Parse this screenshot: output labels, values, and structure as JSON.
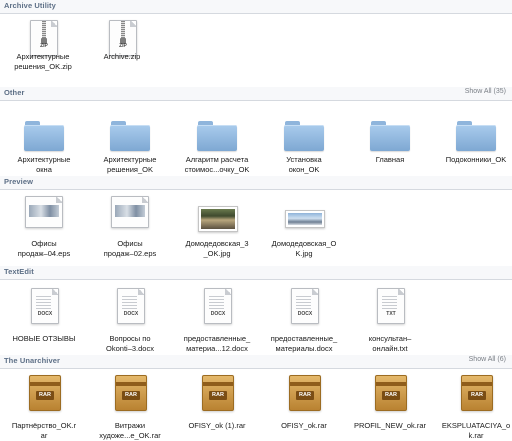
{
  "sections": [
    {
      "title": "Archive Utility",
      "show_all": "",
      "items": [
        {
          "label": "Архитектурные\nрешения_OK.zip",
          "kind": "zip",
          "tag": "ZIP"
        },
        {
          "label": "Archive.zip",
          "kind": "zip",
          "tag": "ZIP"
        }
      ]
    },
    {
      "title": "Other",
      "show_all": "Show All (35)",
      "items": [
        {
          "label": "Архитектурные\nокна",
          "kind": "folder"
        },
        {
          "label": "Архитектурные\nрешения_OK",
          "kind": "folder"
        },
        {
          "label": "Алгаритм расчета\nстоимос...очку_OK",
          "kind": "folder"
        },
        {
          "label": "Установка\nокон_OK",
          "kind": "folder"
        },
        {
          "label": "Главная",
          "kind": "folder"
        },
        {
          "label": "Подоконники_OK",
          "kind": "folder"
        }
      ]
    },
    {
      "title": "Preview",
      "show_all": "",
      "items": [
        {
          "label": "Офисы\nпродаж–04.eps",
          "kind": "eps"
        },
        {
          "label": "Офисы\nпродаж–02.eps",
          "kind": "eps"
        },
        {
          "label": "Домодедовская_3\n_OK.jpg",
          "kind": "photo"
        },
        {
          "label": "Домодедовская_О\nK.jpg",
          "kind": "photo2"
        }
      ]
    },
    {
      "title": "TextEdit",
      "show_all": "",
      "items": [
        {
          "label": "НОВЫЕ ОТЗЫВЫ",
          "kind": "doc",
          "tag": "DOCX"
        },
        {
          "label": "Вопросы по\nOkonti–3.docx",
          "kind": "doc",
          "tag": "DOCX"
        },
        {
          "label": "предоставленные_\nматериа...12.docx",
          "kind": "doc",
          "tag": "DOCX"
        },
        {
          "label": "предоставленные_\nматериалы.docx",
          "kind": "doc",
          "tag": "DOCX"
        },
        {
          "label": "консультан–\nонлайн.txt",
          "kind": "doc",
          "tag": "TXT"
        }
      ]
    },
    {
      "title": "The Unarchiver",
      "show_all": "Show All (6)",
      "items": [
        {
          "label": "Партнёрство_OK.r\nar",
          "kind": "rar",
          "tag": "RAR"
        },
        {
          "label": "Витражи\nхудоже...е_OK.rar",
          "kind": "rar",
          "tag": "RAR"
        },
        {
          "label": "OFISY_ok (1).rar",
          "kind": "rar",
          "tag": "RAR"
        },
        {
          "label": "OFISY_ok.rar",
          "kind": "rar",
          "tag": "RAR"
        },
        {
          "label": "PROFIL_NEW_ok.rar",
          "kind": "rar",
          "tag": "RAR"
        },
        {
          "label": "EKSPLUATACIYA_o\nk.rar",
          "kind": "rar",
          "tag": "RAR"
        }
      ]
    }
  ]
}
